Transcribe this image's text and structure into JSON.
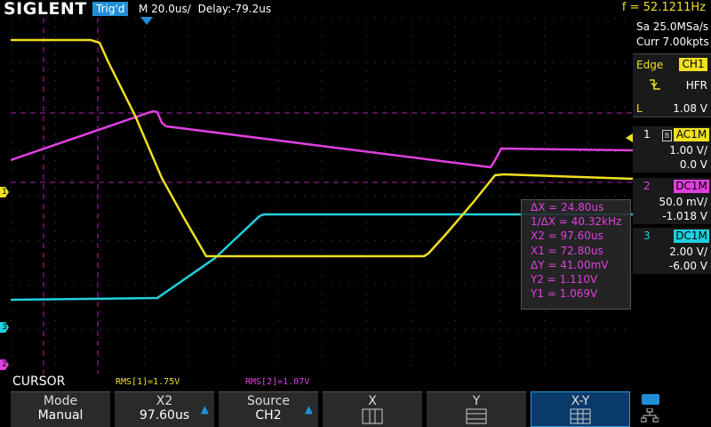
{
  "brand": "SIGLENT",
  "trigger_status": "Trig'd",
  "timebase": "M 20.0us/",
  "delay": "Delay:-79.2us",
  "frequency": "f = 52.1211Hz",
  "acquisition": {
    "sample_rate": "Sa 25.0MSa/s",
    "memory": "Curr 7.00kpts"
  },
  "trigger_panel": {
    "type": "Edge",
    "source": "CH1",
    "coupling": "HFR",
    "level_prefix": "L",
    "level": "1.08 V"
  },
  "channels": [
    {
      "num": "1",
      "coupling": "AC1M",
      "scale": "1.00 V/",
      "offset": "0.0 V",
      "color": "#f0e020"
    },
    {
      "num": "2",
      "coupling": "DC1M",
      "scale": "50.0 mV/",
      "offset": "-1.018 V",
      "color": "#e040e0"
    },
    {
      "num": "3",
      "coupling": "DC1M",
      "scale": "2.00 V/",
      "offset": "-6.00 V",
      "color": "#20d0e0"
    }
  ],
  "cursor_readout": [
    "ΔX = 24.80us",
    "1/ΔX = 40.32kHz",
    "X2 = 97.60us",
    "X1 = 72.80us",
    "ΔY = 41.00mV",
    "Y2 = 1.110V",
    "Y1 = 1.069V"
  ],
  "status_bar": {
    "mode_label": "CURSOR",
    "rms1": "RMS[1]=1.75V",
    "rms2": "RMS[2]=1.07V"
  },
  "menu": {
    "mode": {
      "title": "Mode",
      "value": "Manual"
    },
    "x2": {
      "title": "X2",
      "value": "97.60us"
    },
    "source": {
      "title": "Source",
      "value": "CH2"
    },
    "x": {
      "title": "X"
    },
    "y": {
      "title": "Y"
    },
    "xy": {
      "title": "X-Y"
    }
  },
  "channel_markers": [
    "1",
    "3",
    "2"
  ]
}
